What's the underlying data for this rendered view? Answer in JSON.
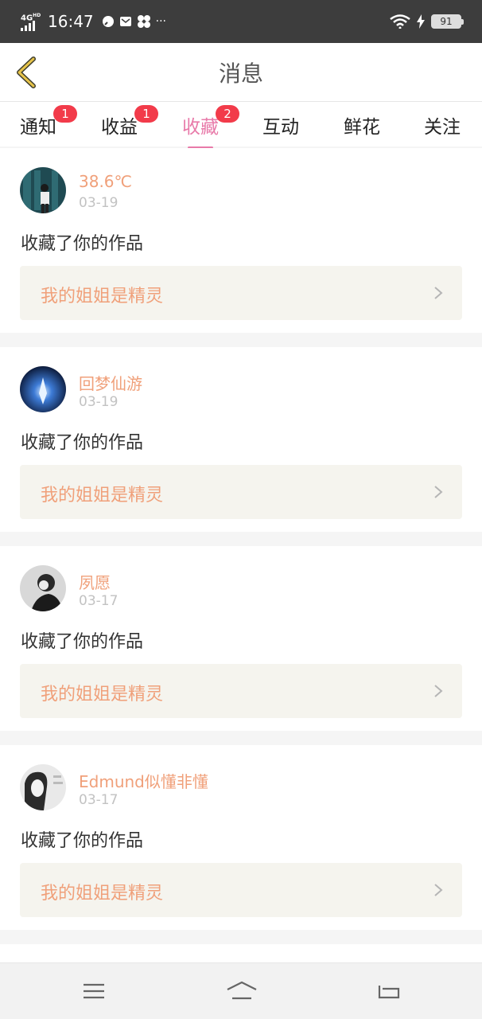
{
  "status": {
    "network": "4G HD",
    "time": "16:47",
    "icons": [
      "whatsapp-icon",
      "mail-icon",
      "fan-icon",
      "more-icon"
    ],
    "more": "···",
    "battery": "91"
  },
  "header": {
    "title": "消息"
  },
  "tabs": [
    {
      "label": "通知",
      "badge": "1",
      "active": false
    },
    {
      "label": "收益",
      "badge": "1",
      "active": false
    },
    {
      "label": "收藏",
      "badge": "2",
      "active": true
    },
    {
      "label": "互动",
      "badge": "",
      "active": false
    },
    {
      "label": "鲜花",
      "badge": "",
      "active": false
    },
    {
      "label": "关注",
      "badge": "",
      "active": false
    }
  ],
  "items": [
    {
      "name": "38.6℃",
      "date": "03-19",
      "action": "收藏了你的作品",
      "work": "我的姐姐是精灵"
    },
    {
      "name": "回梦仙游",
      "date": "03-19",
      "action": "收藏了你的作品",
      "work": "我的姐姐是精灵"
    },
    {
      "name": "夙愿",
      "date": "03-17",
      "action": "收藏了你的作品",
      "work": "我的姐姐是精灵"
    },
    {
      "name": "Edmund似懂非懂",
      "date": "03-17",
      "action": "收藏了你的作品",
      "work": "我的姐姐是精灵"
    }
  ],
  "colors": {
    "accent": "#e87aa9",
    "badge": "#f23b4a",
    "name": "#f0a07a",
    "back": "#e6c34a"
  }
}
